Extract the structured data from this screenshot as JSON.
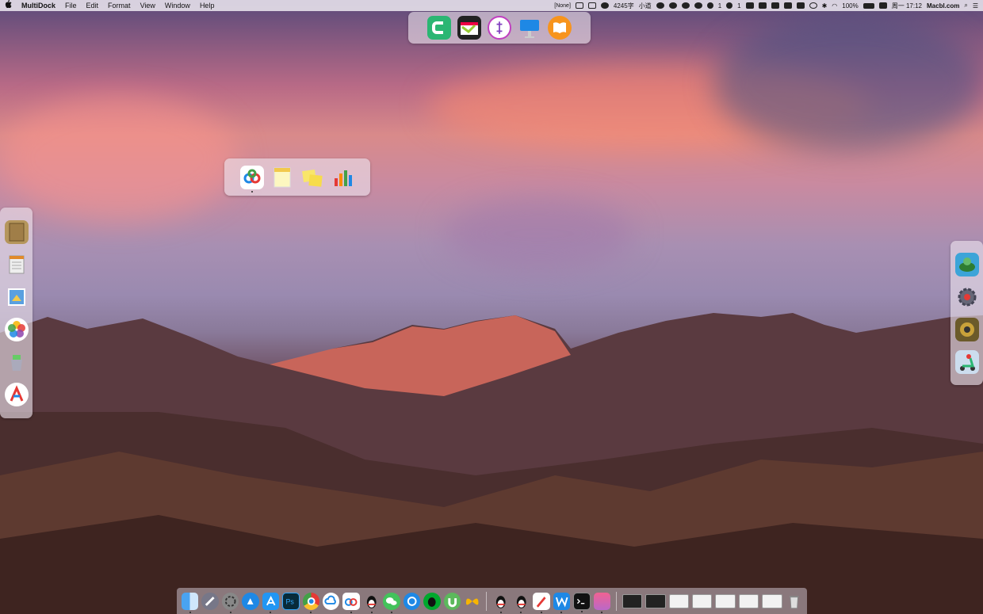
{
  "menubar": {
    "apple": "",
    "app_name": "MultiDock",
    "menus": [
      "File",
      "Edit",
      "Format",
      "View",
      "Window",
      "Help"
    ],
    "status": {
      "input_mode": "[None]",
      "word_count": "4245字",
      "user": "小道",
      "notif_1": "1",
      "notif_2": "1",
      "notif_3": "1",
      "battery": "100%",
      "datetime": "周一 17:12",
      "site": "Macbl.com"
    }
  },
  "docks": {
    "top": [
      "camtasia-icon",
      "final-cut-icon",
      "istat-icon",
      "keynote-icon",
      "ibooks-icon"
    ],
    "middle": [
      "baidu-netdisk-icon",
      "notes-icon",
      "stickies-icon",
      "numbers-icon"
    ],
    "left": [
      "notebook-icon",
      "notepad-icon",
      "preview-icon",
      "photos-icon",
      "archiver-icon",
      "affinity-icon"
    ],
    "right": [
      "game-turtle-icon",
      "gear-app-icon",
      "character-icon",
      "scooter-icon"
    ]
  },
  "bottom_dock": {
    "apps": [
      "finder-icon",
      "launchpad-icon",
      "system-preferences-icon",
      "safari-icon",
      "app-store-icon",
      "photoshop-icon",
      "chrome-icon",
      "icloud-icon",
      "baidu-netdisk-icon",
      "qq-icon",
      "wechat-icon",
      "edge-icon",
      "evernote-icon",
      "utorrent-icon",
      "butterfly-icon",
      "qq-icon-2",
      "qq-icon-3",
      "pencil-icon",
      "wps-icon",
      "terminal-icon",
      "ssh-icon"
    ],
    "windows": [
      "terminal-window",
      "terminal-window-2",
      "window-thumb-1",
      "window-thumb-2",
      "window-thumb-3",
      "window-thumb-4",
      "window-thumb-5"
    ],
    "trash": "trash-icon"
  },
  "colors": {
    "menubar_bg": "#ece8f0",
    "dock_bg": "#ebe2eb",
    "accent_green": "#2bb673",
    "accent_blue": "#1e88e5"
  }
}
